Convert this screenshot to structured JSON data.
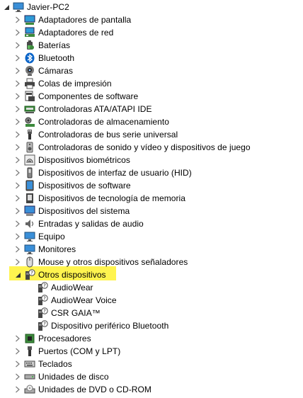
{
  "root": {
    "label": "Javier-PC2",
    "icon": "computer-icon"
  },
  "categories": [
    {
      "label": "Adaptadores de pantalla",
      "icon": "display-adapter-icon"
    },
    {
      "label": "Adaptadores de red",
      "icon": "network-adapter-icon"
    },
    {
      "label": "Baterías",
      "icon": "battery-icon"
    },
    {
      "label": "Bluetooth",
      "icon": "bluetooth-icon"
    },
    {
      "label": "Cámaras",
      "icon": "camera-icon"
    },
    {
      "label": "Colas de impresión",
      "icon": "printer-icon"
    },
    {
      "label": "Componentes de software",
      "icon": "software-component-icon"
    },
    {
      "label": "Controladoras ATA/ATAPI IDE",
      "icon": "ide-controller-icon"
    },
    {
      "label": "Controladoras de almacenamiento",
      "icon": "storage-controller-icon"
    },
    {
      "label": "Controladoras de bus serie universal",
      "icon": "usb-icon"
    },
    {
      "label": "Controladoras de sonido y vídeo y dispositivos de juego",
      "icon": "speaker-icon"
    },
    {
      "label": "Dispositivos biométricos",
      "icon": "fingerprint-icon"
    },
    {
      "label": "Dispositivos de interfaz de usuario (HID)",
      "icon": "hid-icon"
    },
    {
      "label": "Dispositivos de software",
      "icon": "software-device-icon"
    },
    {
      "label": "Dispositivos de tecnología de memoria",
      "icon": "memory-icon"
    },
    {
      "label": "Dispositivos del sistema",
      "icon": "system-device-icon"
    },
    {
      "label": "Entradas y salidas de audio",
      "icon": "audio-io-icon"
    },
    {
      "label": "Equipo",
      "icon": "monitor-icon"
    },
    {
      "label": "Monitores",
      "icon": "monitor-icon"
    },
    {
      "label": "Mouse y otros dispositivos señaladores",
      "icon": "mouse-icon"
    },
    {
      "label": "Otros dispositivos",
      "icon": "unknown-device-icon",
      "expanded": true,
      "highlight_color": "#fff44f",
      "children": [
        {
          "label": "AudioWear",
          "icon": "unknown-device-icon"
        },
        {
          "label": "AudioWear Voice",
          "icon": "unknown-device-icon"
        },
        {
          "label": "CSR GAIA™",
          "icon": "unknown-device-icon"
        },
        {
          "label": "Dispositivo periférico Bluetooth",
          "icon": "unknown-device-icon"
        }
      ]
    },
    {
      "label": "Procesadores",
      "icon": "processor-icon"
    },
    {
      "label": "Puertos (COM y LPT)",
      "icon": "port-icon"
    },
    {
      "label": "Teclados",
      "icon": "keyboard-icon"
    },
    {
      "label": "Unidades de disco",
      "icon": "disk-drive-icon"
    },
    {
      "label": "Unidades de DVD o CD-ROM",
      "icon": "dvd-drive-icon"
    }
  ],
  "colors": {
    "highlight": "#fff44f",
    "arrow": "#7a7a7a",
    "text": "#000000"
  }
}
